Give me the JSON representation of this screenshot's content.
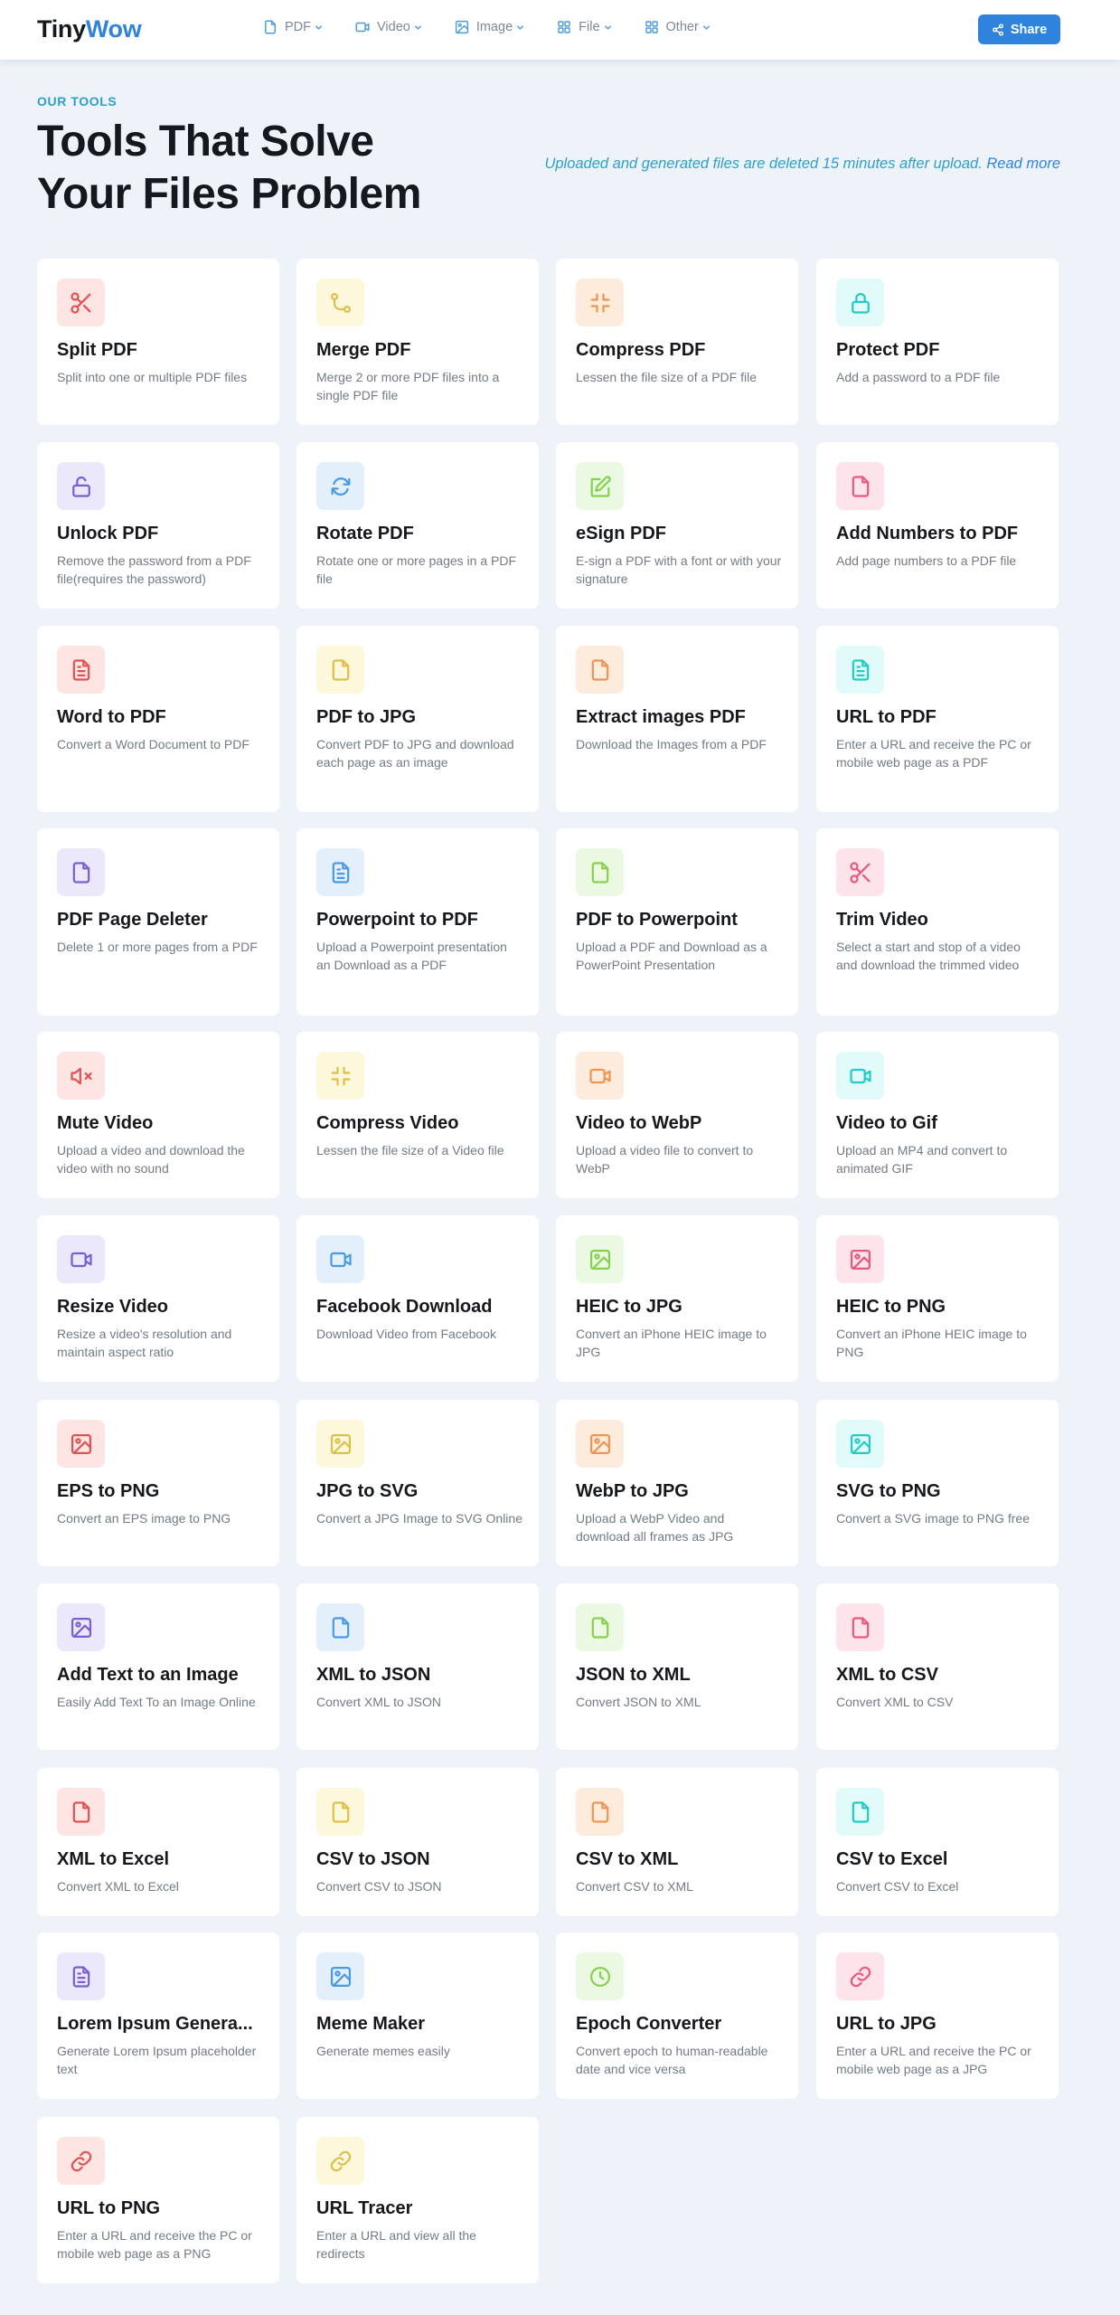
{
  "header": {
    "logo_part1": "Tiny",
    "logo_part2": "Wow",
    "nav": [
      {
        "label": "PDF",
        "icon": "file-icon"
      },
      {
        "label": "Video",
        "icon": "video-icon"
      },
      {
        "label": "Image",
        "icon": "image-icon"
      },
      {
        "label": "File",
        "icon": "grid-icon"
      },
      {
        "label": "Other",
        "icon": "grid-icon"
      }
    ],
    "share_label": "Share"
  },
  "hero": {
    "eyebrow": "OUR TOOLS",
    "title": "Tools That Solve Your Files Problem",
    "notice_text": "Uploaded and generated files are deleted 15 minutes after upload. ",
    "notice_link": "Read more"
  },
  "tools": [
    {
      "title": "Split PDF",
      "desc": "Split into one or multiple PDF files",
      "icon": "scissors-icon",
      "color": "red"
    },
    {
      "title": "Merge PDF",
      "desc": "Merge 2 or more PDF files into a single PDF file",
      "icon": "merge-icon",
      "color": "yel"
    },
    {
      "title": "Compress PDF",
      "desc": "Lessen the file size of a PDF file",
      "icon": "compress-icon",
      "color": "ora"
    },
    {
      "title": "Protect PDF",
      "desc": "Add a password to a PDF file",
      "icon": "lock-icon",
      "color": "cya"
    },
    {
      "title": "Unlock PDF",
      "desc": "Remove the password from a PDF file(requires the password)",
      "icon": "unlock-icon",
      "color": "pur"
    },
    {
      "title": "Rotate PDF",
      "desc": "Rotate one or more pages in a PDF file",
      "icon": "rotate-icon",
      "color": "blu"
    },
    {
      "title": "eSign PDF",
      "desc": "E-sign a PDF with a font or with your signature",
      "icon": "edit-icon",
      "color": "gre"
    },
    {
      "title": "Add Numbers to PDF",
      "desc": "Add page numbers to a PDF file",
      "icon": "file-icon",
      "color": "pin"
    },
    {
      "title": "Word to PDF",
      "desc": "Convert a Word Document to PDF",
      "icon": "file-text-icon",
      "color": "red"
    },
    {
      "title": "PDF to JPG",
      "desc": "Convert PDF to JPG and download each page as an image",
      "icon": "file-icon",
      "color": "yel"
    },
    {
      "title": "Extract images PDF",
      "desc": "Download the Images from a PDF",
      "icon": "file-icon",
      "color": "ora"
    },
    {
      "title": "URL to PDF",
      "desc": "Enter a URL and receive the PC or mobile web page as a PDF",
      "icon": "file-text-icon",
      "color": "cya"
    },
    {
      "title": "PDF Page Deleter",
      "desc": "Delete 1 or more pages from a PDF",
      "icon": "file-icon",
      "color": "pur"
    },
    {
      "title": "Powerpoint to PDF",
      "desc": "Upload a Powerpoint presentation an Download as a PDF",
      "icon": "file-text-icon",
      "color": "blu"
    },
    {
      "title": "PDF to Powerpoint",
      "desc": "Upload a PDF and Download as a PowerPoint Presentation",
      "icon": "file-icon",
      "color": "gre"
    },
    {
      "title": "Trim Video",
      "desc": "Select a start and stop of a video and download the trimmed video",
      "icon": "scissors-icon",
      "color": "pin"
    },
    {
      "title": "Mute Video",
      "desc": "Upload a video and download the video with no sound",
      "icon": "mute-icon",
      "color": "red"
    },
    {
      "title": "Compress Video",
      "desc": "Lessen the file size of a Video file",
      "icon": "compress-icon",
      "color": "yel"
    },
    {
      "title": "Video to WebP",
      "desc": "Upload a video file to convert to WebP",
      "icon": "video-icon",
      "color": "ora"
    },
    {
      "title": "Video to Gif",
      "desc": "Upload an MP4 and convert to animated GIF",
      "icon": "video-icon",
      "color": "cya"
    },
    {
      "title": "Resize Video",
      "desc": "Resize a video's resolution and maintain aspect ratio",
      "icon": "video-icon",
      "color": "pur"
    },
    {
      "title": "Facebook Download",
      "desc": "Download Video from Facebook",
      "icon": "video-icon",
      "color": "blu"
    },
    {
      "title": "HEIC to JPG",
      "desc": "Convert an iPhone HEIC image to JPG",
      "icon": "image-icon",
      "color": "gre"
    },
    {
      "title": "HEIC to PNG",
      "desc": "Convert an iPhone HEIC image to PNG",
      "icon": "image-icon",
      "color": "pin"
    },
    {
      "title": "EPS to PNG",
      "desc": "Convert an EPS image to PNG",
      "icon": "image-icon",
      "color": "red"
    },
    {
      "title": "JPG to SVG",
      "desc": "Convert a JPG Image to SVG Online",
      "icon": "image-icon",
      "color": "yel"
    },
    {
      "title": "WebP to JPG",
      "desc": "Upload a WebP Video and download all frames as JPG",
      "icon": "image-icon",
      "color": "ora"
    },
    {
      "title": "SVG to PNG",
      "desc": "Convert a SVG image to PNG free",
      "icon": "image-icon",
      "color": "cya"
    },
    {
      "title": "Add Text to an Image",
      "desc": "Easily Add Text To an Image Online",
      "icon": "image-icon",
      "color": "pur"
    },
    {
      "title": "XML to JSON",
      "desc": "Convert XML to JSON",
      "icon": "file-icon",
      "color": "blu"
    },
    {
      "title": "JSON to XML",
      "desc": "Convert JSON to XML",
      "icon": "file-icon",
      "color": "gre"
    },
    {
      "title": "XML to CSV",
      "desc": "Convert XML to CSV",
      "icon": "file-icon",
      "color": "pin"
    },
    {
      "title": "XML to Excel",
      "desc": "Convert XML to Excel",
      "icon": "file-icon",
      "color": "red"
    },
    {
      "title": "CSV to JSON",
      "desc": "Convert CSV to JSON",
      "icon": "file-icon",
      "color": "yel"
    },
    {
      "title": "CSV to XML",
      "desc": "Convert CSV to XML",
      "icon": "file-icon",
      "color": "ora"
    },
    {
      "title": "CSV to Excel",
      "desc": "Convert CSV to Excel",
      "icon": "file-icon",
      "color": "cya"
    },
    {
      "title": "Lorem Ipsum Genera...",
      "desc": "Generate Lorem Ipsum placeholder text",
      "icon": "file-text-icon",
      "color": "pur"
    },
    {
      "title": "Meme Maker",
      "desc": "Generate memes easily",
      "icon": "image-icon",
      "color": "blu"
    },
    {
      "title": "Epoch Converter",
      "desc": "Convert epoch to human-readable date and vice versa",
      "icon": "clock-icon",
      "color": "gre"
    },
    {
      "title": "URL to JPG",
      "desc": "Enter a URL and receive the PC or mobile web page as a JPG",
      "icon": "link-icon",
      "color": "pin"
    },
    {
      "title": "URL to PNG",
      "desc": "Enter a URL and receive the PC or mobile web page as a PNG",
      "icon": "link-icon",
      "color": "red"
    },
    {
      "title": "URL Tracer",
      "desc": "Enter a URL and view all the redirects",
      "icon": "link-icon",
      "color": "yel"
    }
  ]
}
